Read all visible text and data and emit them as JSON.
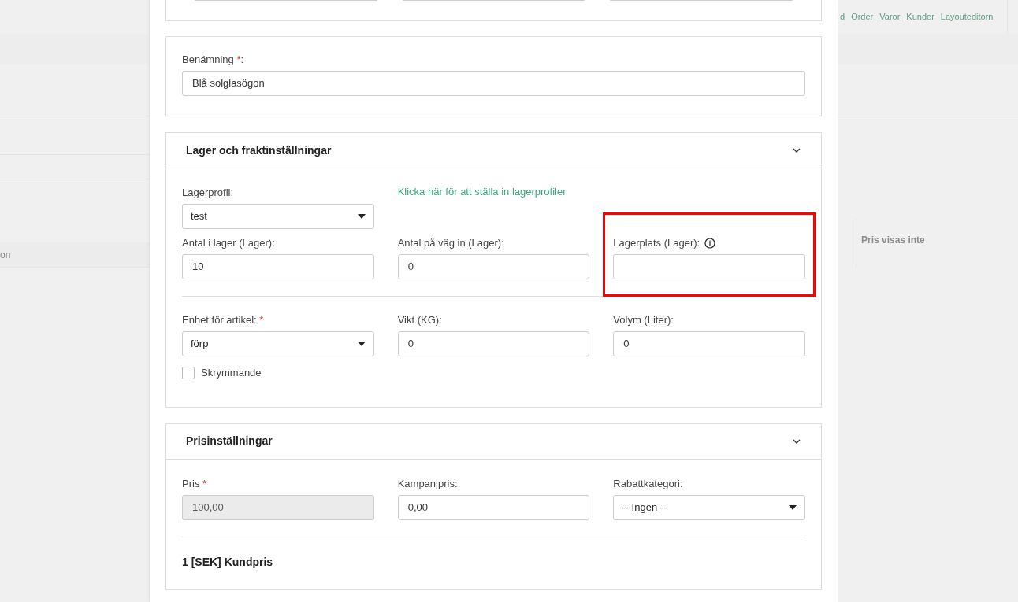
{
  "background": {
    "nav_links": [
      "d",
      "Order",
      "Varor",
      "Kunder",
      "Layouteditorn"
    ],
    "left_text": "on",
    "right_text": "Pris visas inte"
  },
  "name_card": {
    "label": "Benämning ",
    "required_mark": "*",
    "label_end": ":",
    "value": "Blå solglasögon"
  },
  "sections": [
    {
      "title": "Lager och fraktinställningar",
      "expanded": true,
      "rows": [
        [
          {
            "kind": "select",
            "label": "Lagerprofil:",
            "value": "test"
          },
          {
            "kind": "link",
            "text": "Klicka här för att ställa in lagerprofiler"
          }
        ],
        [
          {
            "kind": "input",
            "label": "Antal i lager (Lager):",
            "value": "10"
          },
          {
            "kind": "input",
            "label": "Antal på väg in (Lager):",
            "value": "0"
          },
          {
            "kind": "input",
            "label": "Lagerplats (Lager):",
            "info": true,
            "highlighted": true
          }
        ],
        [
          {
            "kind": "divider"
          }
        ],
        [
          {
            "kind": "select",
            "label": "Enhet för artikel: ",
            "required_mark": "*",
            "value": "förp",
            "checkbox": {
              "label": "Skrymmande",
              "checked": false
            }
          },
          {
            "kind": "input",
            "label": "Vikt (KG):",
            "value": "0"
          },
          {
            "kind": "input",
            "label": "Volym (Liter):",
            "value": "0"
          }
        ]
      ]
    },
    {
      "title": "Prisinställningar",
      "expanded": true,
      "rows": [
        [
          {
            "kind": "input",
            "label": "Pris ",
            "required_mark": "*",
            "value": "100,00",
            "disabled": true
          },
          {
            "kind": "input",
            "label": "Kampanjpris:",
            "value": "0,00"
          },
          {
            "kind": "select",
            "label": "Rabattkategori:",
            "value": "-- Ingen --"
          }
        ],
        [
          {
            "kind": "divider"
          }
        ],
        [
          {
            "kind": "heading",
            "text": "1 [SEK] Kundpris"
          }
        ]
      ]
    }
  ]
}
